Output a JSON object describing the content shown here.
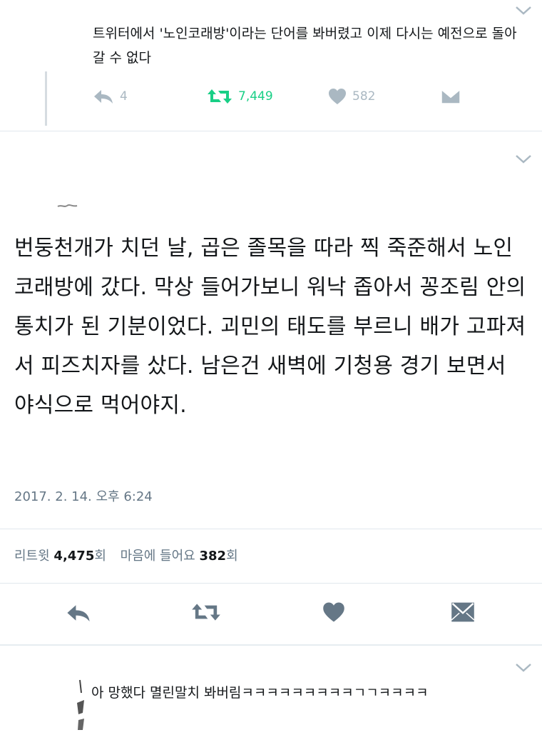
{
  "top_tweet": {
    "text": "트위터에서 '노인코래방'이라는 단어를 봐버렸고 이제 다시는 예전으로 돌아갈 수 없다",
    "reply_count": "4",
    "retweet_count": "7,449",
    "like_count": "582"
  },
  "main_tweet": {
    "text": "번둥천개가 치던 날, 곱은 졸목을 따라 찍 죽준해서 노인코래방에 갔다. 막상 들어가보니 워낙 좁아서 꽁조림 안의 통치가 된 기분이었다. 괴민의 태도를 부르니 배가 고파져서 피즈치자를 샀다. 남은건 새벽에 기청용 경기 보면서 야식으로 먹어야지.",
    "timestamp": "2017. 2. 14. 오후 6:24",
    "retweets_label": "리트윗",
    "retweets_value": "4,475",
    "retweets_unit": "회",
    "likes_label": "마음에 들어요",
    "likes_value": "382",
    "likes_unit": "회"
  },
  "reply_tweet": {
    "text": "아 망했다 멸린말치 봐버림ㅋㅋㅋㅋㅋㅋㅋㅋㅋㄱㄱㅋㅋㅋㅋ"
  },
  "colors": {
    "retweet_active": "#19cf86",
    "icon_grey": "#aab8c2",
    "icon_dark": "#657786",
    "text": "#14171a",
    "divider": "#e1e8ed"
  }
}
